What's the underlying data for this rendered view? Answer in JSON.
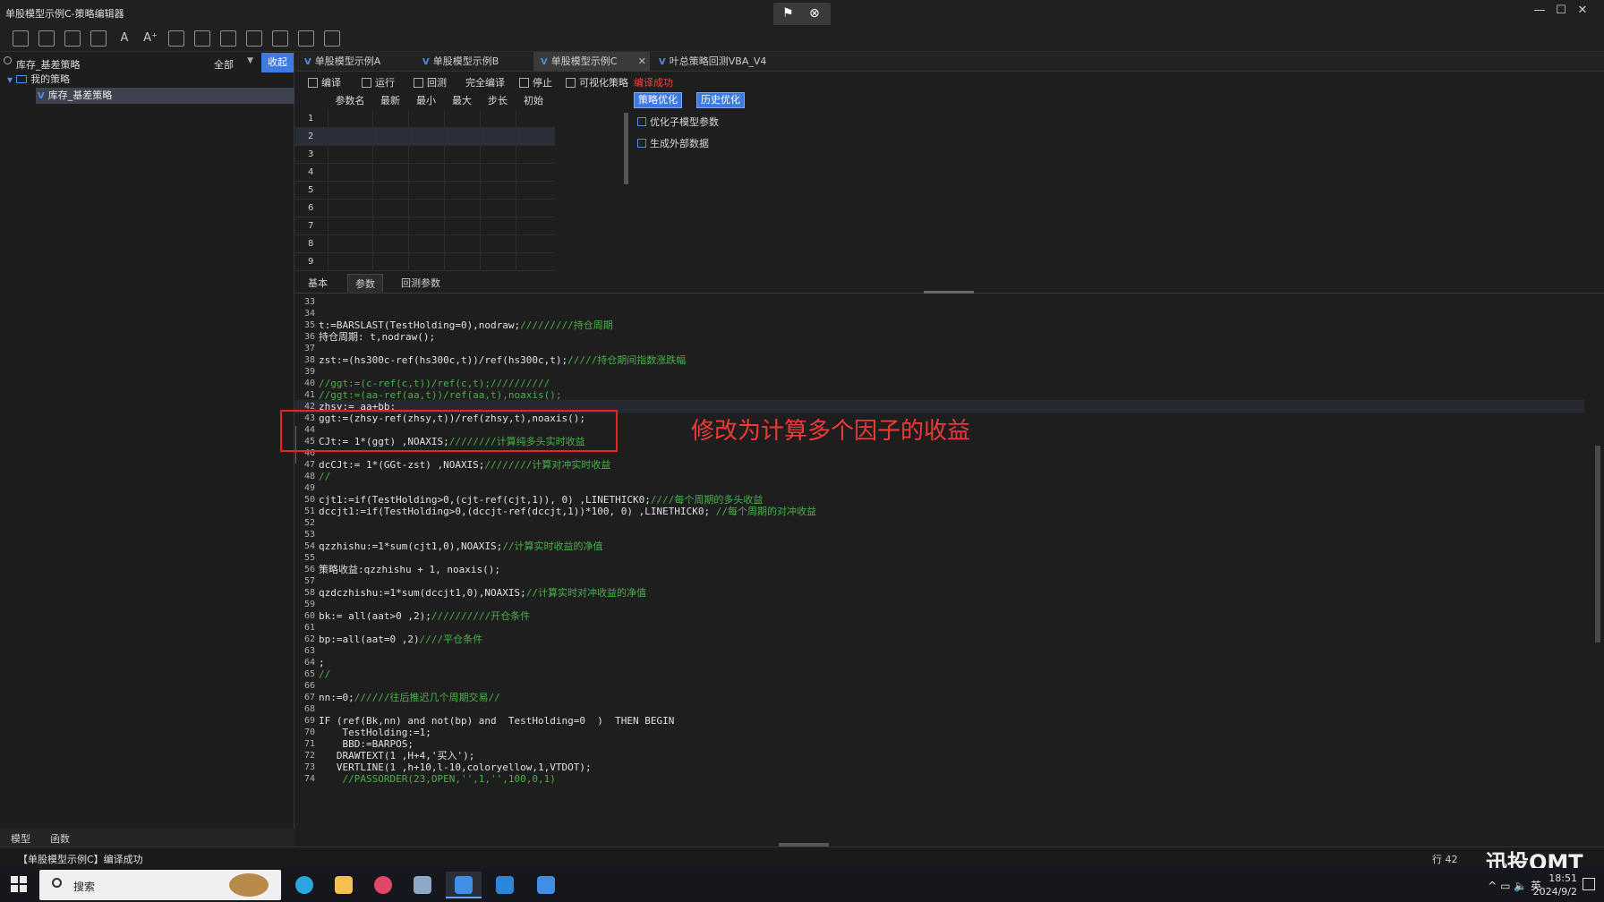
{
  "window": {
    "title": "单股模型示例C-策略编辑器"
  },
  "left_panel": {
    "search_value": "库存_基差策略",
    "filter_selected": "全部",
    "collapse_label": "收起",
    "tree_root": "我的策略",
    "tree_selected": "库存_基差策略",
    "bottom_tabs": [
      "模型",
      "函数"
    ]
  },
  "tabs": [
    "单股模型示例A",
    "单股模型示例B",
    "单股模型示例C",
    "叶总策略回测VBA_V4"
  ],
  "actions": [
    "编译",
    "运行",
    "回测",
    "完全编译",
    "停止",
    "可视化策略"
  ],
  "compile_status": "编译成功",
  "param_grid": {
    "headers": [
      "参数名",
      "最新",
      "最小",
      "最大",
      "步长",
      "初始"
    ],
    "rows": [
      "1",
      "2",
      "3",
      "4",
      "5",
      "6",
      "7",
      "8",
      "9"
    ]
  },
  "options": {
    "strategy_opt": "策略优化",
    "history_opt": "历史优化",
    "checkbox1": "优化子模型参数",
    "checkbox2": "生成外部数据"
  },
  "panel_tabs": [
    "基本",
    "参数",
    "回测参数"
  ],
  "code_lines": [
    {
      "n": "33",
      "t": ""
    },
    {
      "n": "34",
      "t": ""
    },
    {
      "n": "35",
      "t": "t:=BARSLAST(TestHolding=0),nodraw;",
      "c": "/////////持仓周期"
    },
    {
      "n": "36",
      "t": "持仓周期: t,nodraw();"
    },
    {
      "n": "37",
      "t": ""
    },
    {
      "n": "38",
      "t": "zst:=(hs300c-ref(hs300c,t))/ref(hs300c,t);",
      "c": "/////持仓期间指数涨跌幅"
    },
    {
      "n": "39",
      "t": ""
    },
    {
      "n": "40",
      "t": "",
      "c": "//ggt:=(c-ref(c,t))/ref(c,t);//////////"
    },
    {
      "n": "41",
      "t": "",
      "c": "//ggt:=(aa-ref(aa,t))/ref(aa,t),noaxis();"
    },
    {
      "n": "42",
      "t": "zhsy:= aa+bb;"
    },
    {
      "n": "43",
      "t": "ggt:=(zhsy-ref(zhsy,t))/ref(zhsy,t),noaxis();"
    },
    {
      "n": "44",
      "t": ""
    },
    {
      "n": "45",
      "t": "CJt:= 1*(ggt) ,NOAXIS;",
      "c": "////////计算纯多头实时收益"
    },
    {
      "n": "46",
      "t": ""
    },
    {
      "n": "47",
      "t": "dcCJt:= 1*(GGt-zst) ,NOAXIS;",
      "c": "////////计算对冲实时收益"
    },
    {
      "n": "48",
      "t": "",
      "c": "//"
    },
    {
      "n": "49",
      "t": ""
    },
    {
      "n": "50",
      "t": "cjt1:=if(TestHolding>0,(cjt-ref(cjt,1)), 0) ,LINETHICK0;",
      "c": "////每个周期的多头收益"
    },
    {
      "n": "51",
      "t": "dccjt1:=if(TestHolding>0,(dccjt-ref(dccjt,1))*100, 0) ,LINETHICK0;",
      "c": " //每个周期的对冲收益"
    },
    {
      "n": "52",
      "t": ""
    },
    {
      "n": "53",
      "t": ""
    },
    {
      "n": "54",
      "t": "qzzhishu:=1*sum(cjt1,0),NOAXIS;",
      "c": "//计算实时收益的净值"
    },
    {
      "n": "55",
      "t": ""
    },
    {
      "n": "56",
      "t": "策略收益:qzzhishu + 1, noaxis();"
    },
    {
      "n": "57",
      "t": ""
    },
    {
      "n": "58",
      "t": "qzdczhishu:=1*sum(dccjt1,0),NOAXIS;",
      "c": "//计算实时对冲收益的净值"
    },
    {
      "n": "59",
      "t": ""
    },
    {
      "n": "60",
      "t": "bk:= all(aat>0 ,2);",
      "c": "//////////开仓条件"
    },
    {
      "n": "61",
      "t": ""
    },
    {
      "n": "62",
      "t": "bp:=all(aat=0 ,2)",
      "c": "////平仓条件"
    },
    {
      "n": "63",
      "t": ""
    },
    {
      "n": "64",
      "t": ";"
    },
    {
      "n": "65",
      "t": "",
      "c": "//"
    },
    {
      "n": "66",
      "t": ""
    },
    {
      "n": "67",
      "t": "nn:=0;",
      "c": "//////往后推迟几个周期交易//"
    },
    {
      "n": "68",
      "t": ""
    },
    {
      "n": "69",
      "t": "IF (ref(Bk,nn) and not(bp) and  TestHolding=0  )  THEN BEGIN"
    },
    {
      "n": "70",
      "t": "    TestHolding:=1;"
    },
    {
      "n": "71",
      "t": "    BBD:=BARPOS;"
    },
    {
      "n": "72",
      "t": "   DRAWTEXT(1 ,H+4,'买入');"
    },
    {
      "n": "73",
      "t": "   VERTLINE(1 ,h+10,l-10,coloryellow,1,VTDOT);"
    },
    {
      "n": "74",
      "t": "",
      "c": "    //PASSORDER(23,OPEN,'',1,'',100,0,1)"
    }
  ],
  "annotation": "修改为计算多个因子的收益",
  "status": {
    "message": "【单股模型示例C】编译成功",
    "position": "行 42"
  },
  "watermark": "迅投QMT",
  "taskbar": {
    "search_placeholder": "搜索",
    "tray_text": "英",
    "time": "18:51",
    "date": "2024/9/2"
  }
}
